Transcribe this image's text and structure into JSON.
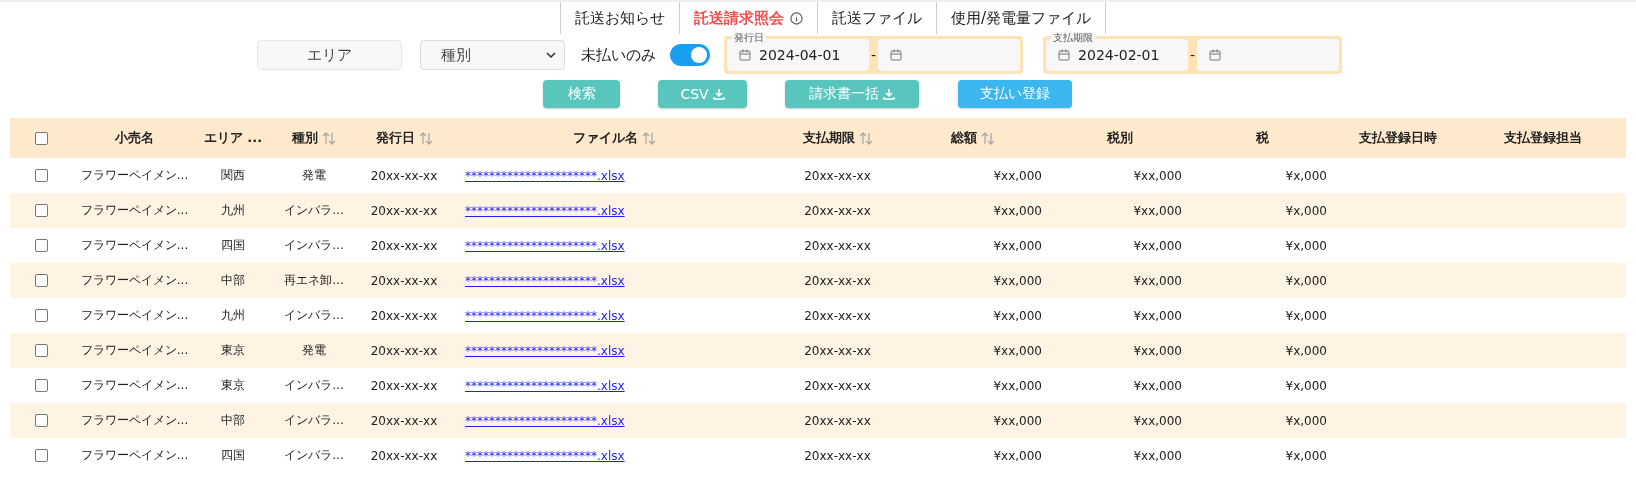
{
  "nav_tabs": [
    {
      "label": "託送お知らせ",
      "selected": false,
      "info": false
    },
    {
      "label": "託送請求照会",
      "selected": true,
      "info": true
    },
    {
      "label": "託送ファイル",
      "selected": false,
      "info": false
    },
    {
      "label": "使用/発電量ファイル",
      "selected": false,
      "info": false
    }
  ],
  "filters": {
    "area": {
      "placeholder": "エリア"
    },
    "type_select": {
      "value": "種別"
    },
    "unpaid_only": {
      "label": "未払いのみ",
      "on": true
    },
    "date_ranges": [
      {
        "label": "発行日",
        "from": "2024-04-01",
        "separator": "-"
      },
      {
        "label": "支払期限",
        "from": "2024-02-01",
        "separator": "-"
      }
    ]
  },
  "actions": [
    {
      "label": "検索",
      "kind": "plain",
      "color": "#59c6be"
    },
    {
      "label": "CSV",
      "kind": "download",
      "color": "#59c6be"
    },
    {
      "label": "請求書一括",
      "kind": "download",
      "color": "#59c6be"
    },
    {
      "label": "支払い登録",
      "kind": "plain",
      "color": "#3bb6ef"
    }
  ],
  "table": {
    "select_all": {
      "checked": false
    },
    "columns": [
      {
        "label": "小売名",
        "sortable": false,
        "kind": "text"
      },
      {
        "label": "エリア ...",
        "sortable": false,
        "kind": "text"
      },
      {
        "label": "種別",
        "sortable": true,
        "kind": "text"
      },
      {
        "label": "発行日",
        "sortable": true,
        "kind": "text"
      },
      {
        "label": "ファイル名",
        "sortable": true,
        "kind": "link"
      },
      {
        "label": "支払期限",
        "sortable": true,
        "kind": "text"
      },
      {
        "label": "総額",
        "sortable": true,
        "kind": "amount"
      },
      {
        "label": "税別",
        "sortable": false,
        "kind": "amount"
      },
      {
        "label": "税",
        "sortable": false,
        "kind": "amount"
      },
      {
        "label": "支払登録日時",
        "sortable": false
      },
      {
        "label": "支払登録担当",
        "sortable": false
      }
    ],
    "rows": [
      {
        "checked": false,
        "cells": [
          "フラワーペイメン...",
          "関西",
          "発電",
          "20xx-xx-xx",
          "**********************.xlsx",
          "20xx-xx-xx",
          "¥xx,000",
          "¥xx,000",
          "¥x,000"
        ]
      },
      {
        "checked": false,
        "cells": [
          "フラワーペイメン...",
          "九州",
          "インバラ...",
          "20xx-xx-xx",
          "**********************.xlsx",
          "20xx-xx-xx",
          "¥xx,000",
          "¥xx,000",
          "¥x,000"
        ]
      },
      {
        "checked": false,
        "cells": [
          "フラワーペイメン...",
          "四国",
          "インバラ...",
          "20xx-xx-xx",
          "**********************.xlsx",
          "20xx-xx-xx",
          "¥xx,000",
          "¥xx,000",
          "¥x,000"
        ]
      },
      {
        "checked": false,
        "cells": [
          "フラワーペイメン...",
          "中部",
          "再エネ卸...",
          "20xx-xx-xx",
          "**********************.xlsx",
          "20xx-xx-xx",
          "¥xx,000",
          "¥xx,000",
          "¥x,000"
        ]
      },
      {
        "checked": false,
        "cells": [
          "フラワーペイメン...",
          "九州",
          "インバラ...",
          "20xx-xx-xx",
          "**********************.xlsx",
          "20xx-xx-xx",
          "¥xx,000",
          "¥xx,000",
          "¥x,000"
        ]
      },
      {
        "checked": false,
        "cells": [
          "フラワーペイメン...",
          "東京",
          "発電",
          "20xx-xx-xx",
          "**********************.xlsx",
          "20xx-xx-xx",
          "¥xx,000",
          "¥xx,000",
          "¥x,000"
        ]
      },
      {
        "checked": false,
        "cells": [
          "フラワーペイメン...",
          "東京",
          "インバラ...",
          "20xx-xx-xx",
          "**********************.xlsx",
          "20xx-xx-xx",
          "¥xx,000",
          "¥xx,000",
          "¥x,000"
        ]
      },
      {
        "checked": false,
        "cells": [
          "フラワーペイメン...",
          "中部",
          "インバラ...",
          "20xx-xx-xx",
          "**********************.xlsx",
          "20xx-xx-xx",
          "¥xx,000",
          "¥xx,000",
          "¥x,000"
        ]
      },
      {
        "checked": false,
        "cells": [
          "フラワーペイメン...",
          "四国",
          "インバラ...",
          "20xx-xx-xx",
          "**********************.xlsx",
          "20xx-xx-xx",
          "¥xx,000",
          "¥xx,000",
          "¥x,000"
        ]
      }
    ]
  }
}
